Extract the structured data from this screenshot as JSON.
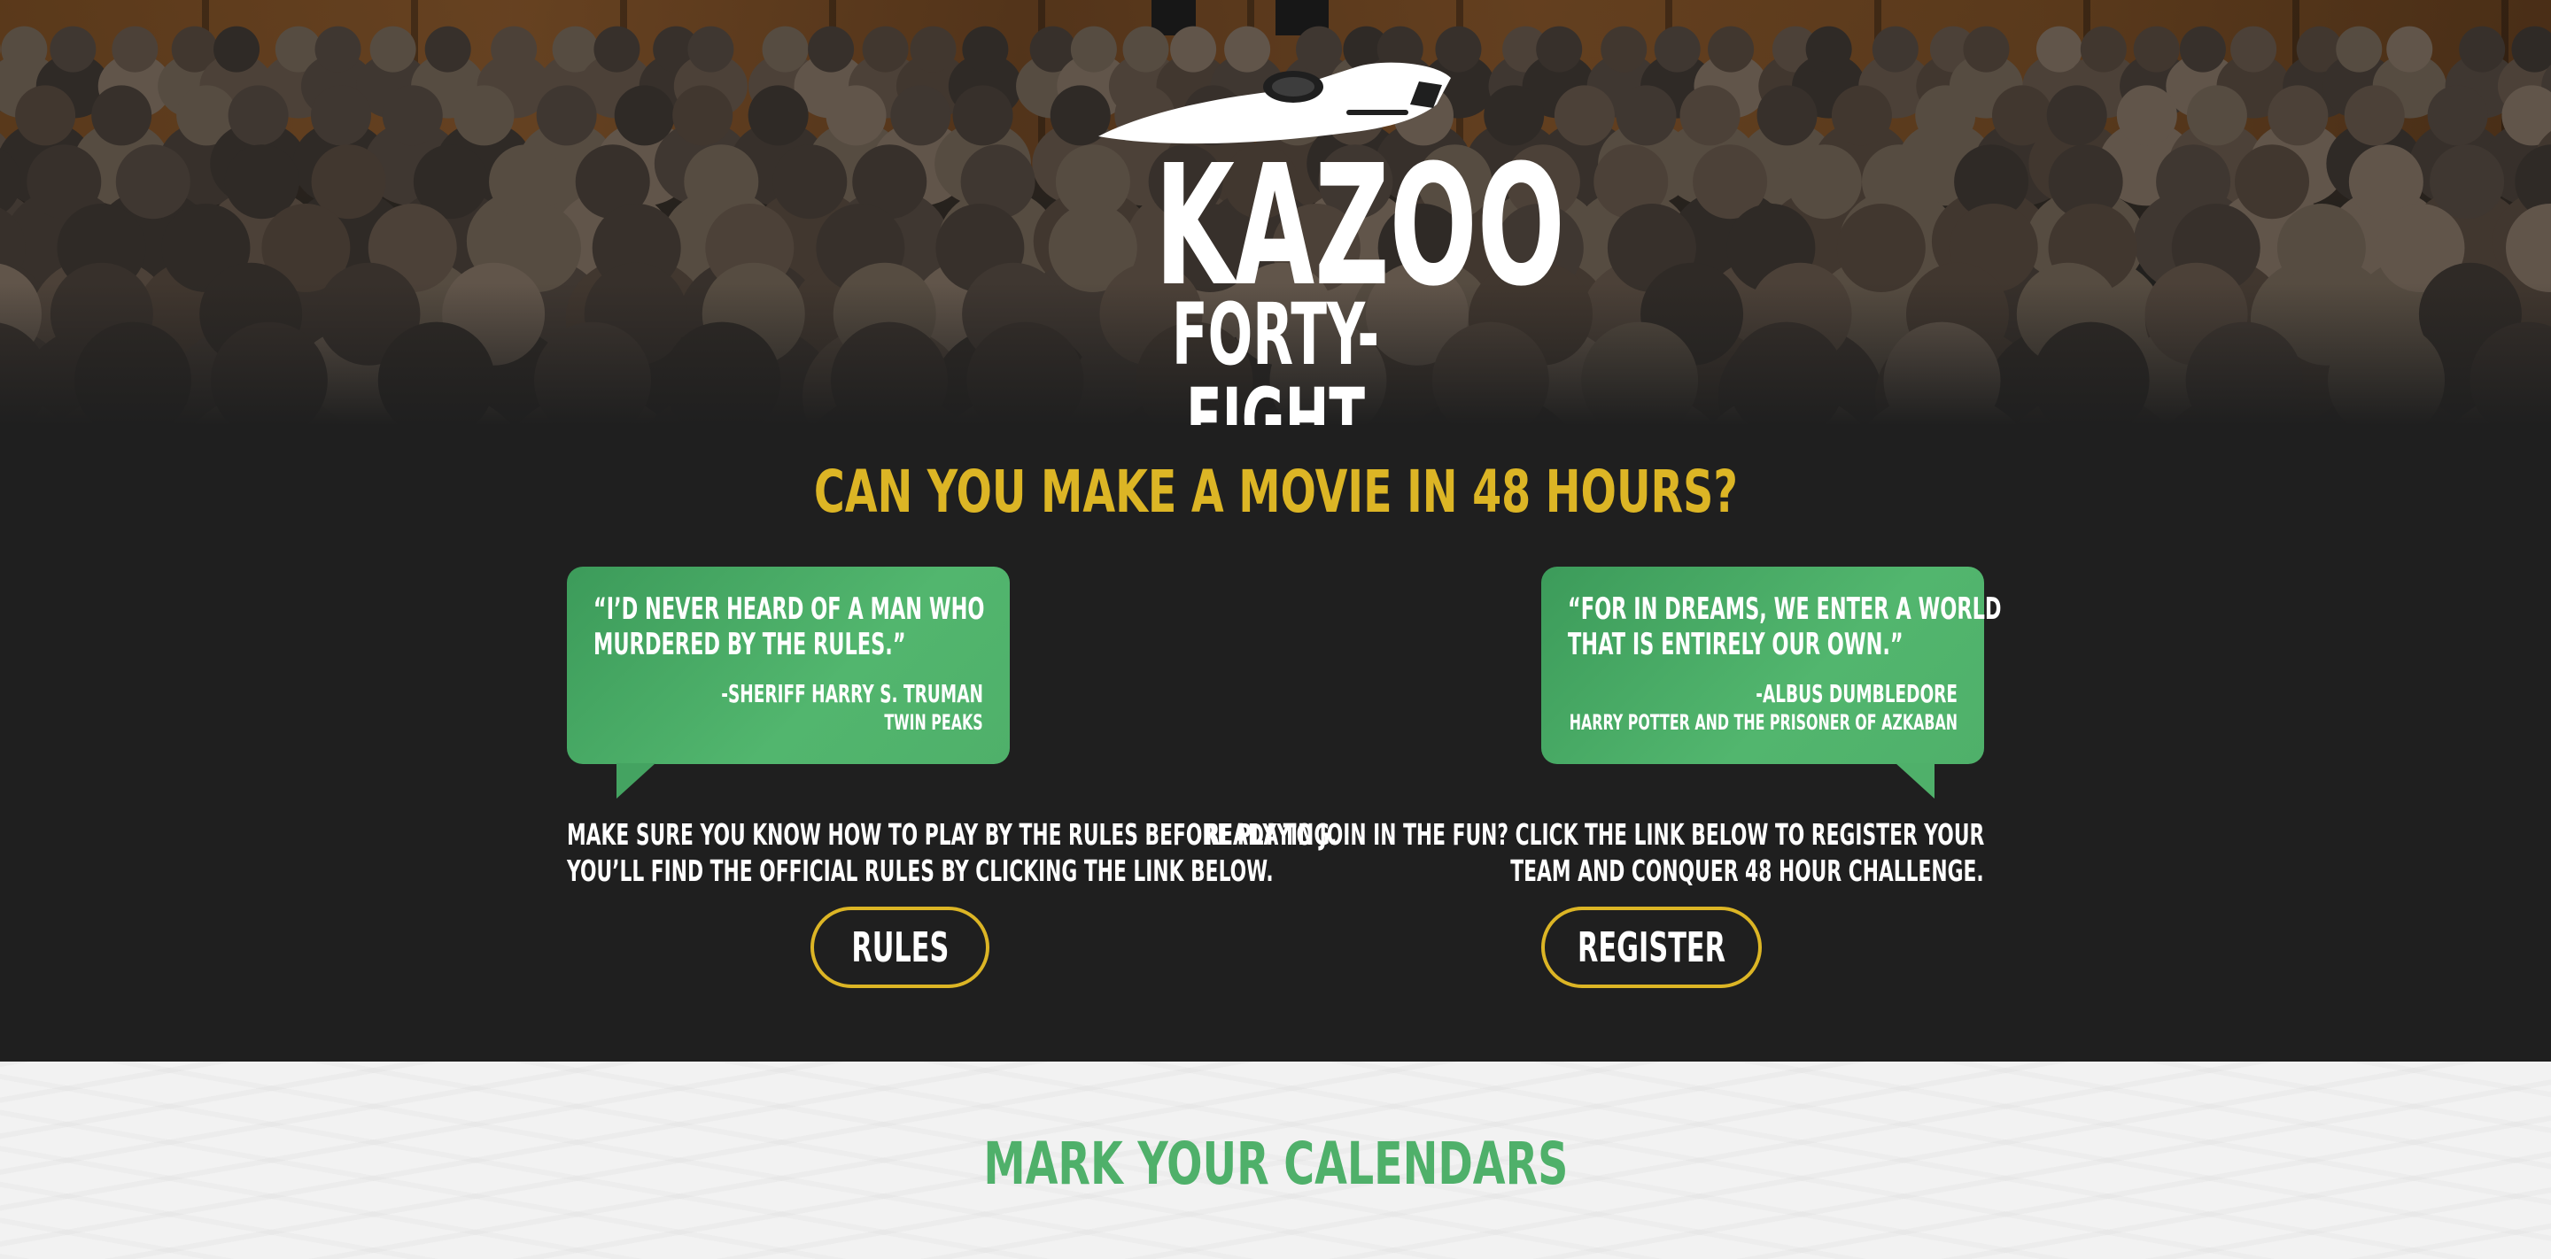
{
  "hero": {
    "logo": {
      "line1": "KAZOO",
      "line2": "FORTY-EIGHT"
    }
  },
  "intro": {
    "headline": "CAN YOU MAKE A MOVIE IN 48 HOURS?"
  },
  "quotes": [
    {
      "line1": "“I’D NEVER HEARD OF A MAN WHO",
      "line2": "MURDERED BY THE RULES.”",
      "attribution": "-SHERIFF HARRY S. TRUMAN",
      "work": "TWIN PEAKS"
    },
    {
      "line1": "“FOR IN DREAMS, WE ENTER A WORLD",
      "line2": "THAT IS ENTIRELY OUR OWN.”",
      "attribution": "-ALBUS DUMBLEDORE",
      "work": "HARRY POTTER AND THE PRISONER OF AZKABAN"
    }
  ],
  "rules": {
    "line1": "MAKE SURE YOU KNOW HOW TO PLAY BY THE RULES BEFORE PLAYING.",
    "line2": "YOU’LL FIND THE OFFICIAL RULES BY CLICKING THE LINK BELOW.",
    "button": "RULES"
  },
  "register": {
    "line1": "READY TO JOIN IN THE FUN? CLICK THE LINK BELOW TO REGISTER YOUR",
    "line2": "TEAM AND CONQUER 48 HOUR CHALLENGE.",
    "button": "REGISTER"
  },
  "calendar": {
    "title": "MARK YOUR CALENDARS"
  },
  "colors": {
    "accent_yellow": "#dcb525",
    "accent_green": "#4fb06a",
    "dark_bg": "#1f1f1f",
    "light_bg": "#f2f2f2"
  }
}
